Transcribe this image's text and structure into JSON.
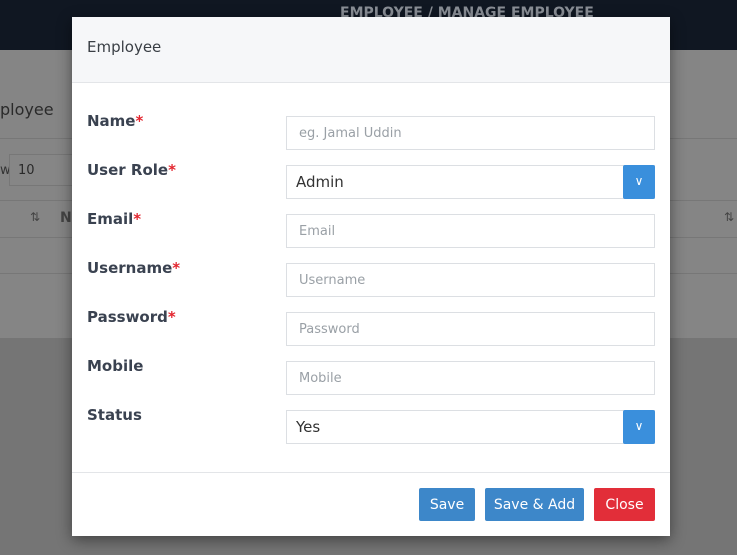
{
  "background": {
    "breadcrumb": "EMPLOYEE / MANAGE EMPLOYEE",
    "page_title": "ployee",
    "show_label": "w",
    "page_size": "10",
    "sort_icon_label": "⇅",
    "column_first_letter": "N"
  },
  "modal": {
    "title": "Employee",
    "fields": [
      {
        "label": "Name",
        "required": "*",
        "placeholder": "eg. Jamal Uddin",
        "value": ""
      },
      {
        "label": "User Role",
        "required": "*",
        "value": "Admin"
      },
      {
        "label": "Email",
        "required": "*",
        "placeholder": "Email",
        "value": ""
      },
      {
        "label": "Username",
        "required": "*",
        "placeholder": "Username",
        "value": ""
      },
      {
        "label": "Password",
        "required": "*",
        "placeholder": "Password",
        "value": ""
      },
      {
        "label": "Mobile",
        "required": "",
        "placeholder": "Mobile",
        "value": ""
      },
      {
        "label": "Status",
        "required": "",
        "value": "Yes"
      }
    ],
    "buttons": {
      "save": "Save",
      "save_add": "Save & Add",
      "close": "Close"
    }
  },
  "colors": {
    "primary": "#3d87c9",
    "danger": "#e22e39",
    "required": "#e3262f"
  }
}
